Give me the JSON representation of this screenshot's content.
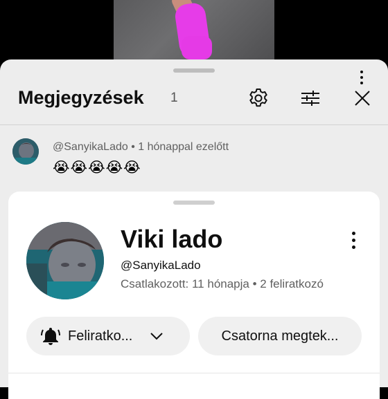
{
  "panel": {
    "title": "Megjegyzések",
    "count": "1"
  },
  "header_icons": {
    "settings": "gear-icon",
    "filter": "sliders-icon",
    "close": "close-icon"
  },
  "comment": {
    "author": "@SanyikaLado",
    "time": "1 hónappal ezelőtt",
    "separator": " • ",
    "text": "😭😭😭😭😭"
  },
  "channel_card": {
    "name": "Viki lado",
    "handle": "@SanyikaLado",
    "joined": "Csatlakozott: 11 hónapja",
    "subscribers": "2 feliratkozó",
    "subscribe_label": "Feliratko...",
    "channel_label": "Csatorna megtek..."
  },
  "colors": {
    "sheet_bg": "#ededed",
    "card_bg": "#ffffff",
    "button_bg": "#f0f0f0",
    "accent_sock": "#e63ce8"
  }
}
